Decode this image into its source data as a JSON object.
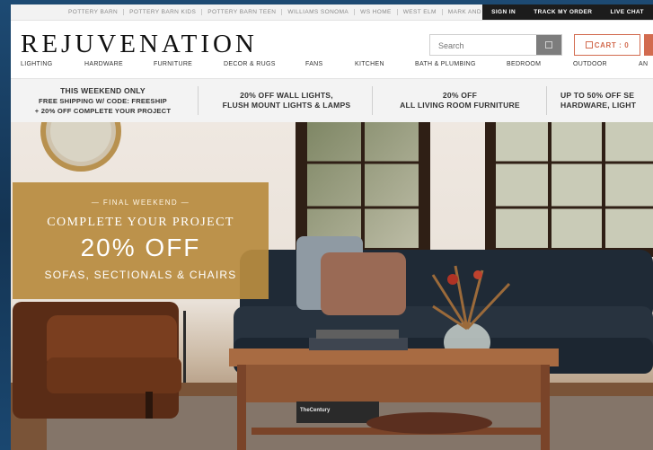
{
  "brand_bar": {
    "links": [
      "POTTERY BARN",
      "POTTERY BARN KIDS",
      "POTTERY BARN TEEN",
      "WILLIAMS SONOMA",
      "WS HOME",
      "WEST ELM",
      "MARK AND GRAHAM"
    ],
    "utility": [
      "SIGN IN",
      "TRACK MY ORDER",
      "LIVE CHAT"
    ]
  },
  "header": {
    "logo": "REJUVENATION",
    "search_placeholder": "Search",
    "cart_label": "CART : 0",
    "search_icon": "search-icon",
    "cart_icon": "bag-icon"
  },
  "nav": [
    "LIGHTING",
    "HARDWARE",
    "FURNITURE",
    "DECOR & RUGS",
    "FANS",
    "KITCHEN",
    "BATH & PLUMBING",
    "BEDROOM",
    "OUTDOOR",
    "AN"
  ],
  "promos": [
    {
      "lines": [
        "THIS WEEKEND ONLY",
        "FREE SHIPPING W/ CODE: FREESHIP",
        "+ 20% OFF COMPLETE YOUR PROJECT"
      ]
    },
    {
      "lines": [
        "20% OFF WALL LIGHTS,",
        "FLUSH MOUNT LIGHTS & LAMPS"
      ]
    },
    {
      "lines": [
        "20% OFF",
        "ALL LIVING ROOM FURNITURE"
      ]
    },
    {
      "lines": [
        "UP TO 50% OFF SE",
        "HARDWARE, LIGHT"
      ]
    }
  ],
  "hero": {
    "eyebrow": "— FINAL WEEKEND —",
    "line1": "COMPLETE YOUR PROJECT",
    "discount": "20% OFF",
    "line3": "SOFAS, SECTIONALS & CHAIRS",
    "book_title": "TheCentury"
  },
  "colors": {
    "accent": "#d26b4f",
    "caption_bg": "#b88c40",
    "utility_bar": "#1c1c1c",
    "sofa": "#1f2a36"
  }
}
